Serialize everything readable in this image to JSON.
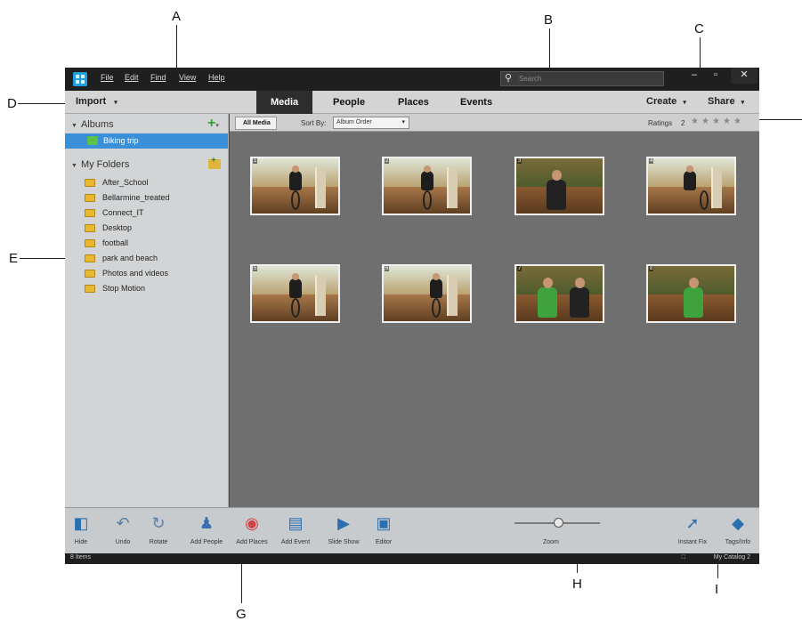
{
  "callouts": [
    "A",
    "B",
    "C",
    "D",
    "E",
    "G",
    "H",
    "I"
  ],
  "menu": [
    "File",
    "Edit",
    "Find",
    "View",
    "Help"
  ],
  "search": {
    "placeholder": "Search"
  },
  "window_buttons": [
    "–",
    "▫",
    "✕"
  ],
  "tabbar": {
    "import_label": "Import",
    "tabs": [
      "Media",
      "People",
      "Places",
      "Events"
    ],
    "active_tab": "Media",
    "create_label": "Create",
    "share_label": "Share"
  },
  "albums": {
    "header": "Albums",
    "items": [
      "Biking trip"
    ]
  },
  "folders": {
    "header": "My Folders",
    "items": [
      "After_School",
      "Bellarmine_treated",
      "Connect_IT",
      "Desktop",
      "football",
      "park and beach",
      "Photos and videos",
      "Stop Motion"
    ]
  },
  "filterbar": {
    "all_media": "All Media",
    "sort_by_label": "Sort By:",
    "sort_by_value": "Album Order",
    "ratings_label": "Ratings",
    "ratings_count": "2"
  },
  "thumbnails": [
    "1",
    "2",
    "3",
    "4",
    "5",
    "6",
    "7",
    "8"
  ],
  "bottom_toolbar": {
    "hide": "Hide",
    "undo": "Undo",
    "rotate": "Rotate",
    "add_people": "Add People",
    "add_places": "Add Places",
    "add_event": "Add Event",
    "slide_show": "Slide Show",
    "editor": "Editor",
    "zoom": "Zoom",
    "instant_fix": "Instant Fix",
    "tags_info": "Tags/Info"
  },
  "status": {
    "items": "8 Items",
    "catalog": "My Catalog 2"
  },
  "colors": {
    "accent_blue": "#3a8fd9",
    "title_bar": "#1f1f1f",
    "grid_bg": "#6f6f6f",
    "plus_green": "#31a52f"
  }
}
